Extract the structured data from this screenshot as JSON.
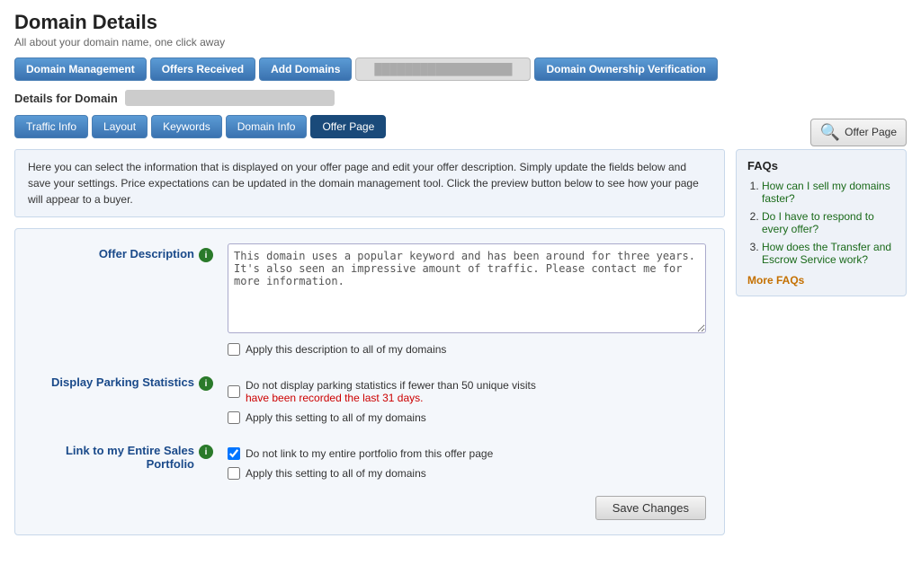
{
  "page": {
    "title": "Domain Details",
    "subtitle": "All about your domain name, one click away"
  },
  "top_nav": {
    "buttons": [
      {
        "id": "domain-management",
        "label": "Domain Management"
      },
      {
        "id": "offers-received",
        "label": "Offers Received"
      },
      {
        "id": "add-domains",
        "label": "Add Domains"
      }
    ],
    "domain_placeholder": "██████████████████",
    "right_button": {
      "id": "domain-ownership",
      "label": "Domain Ownership Verification"
    }
  },
  "details": {
    "label": "Details for Domain",
    "domain_name": "██████████████████"
  },
  "sub_tabs": [
    {
      "id": "traffic-info",
      "label": "Traffic Info",
      "active": false
    },
    {
      "id": "layout",
      "label": "Layout",
      "active": false
    },
    {
      "id": "keywords",
      "label": "Keywords",
      "active": false
    },
    {
      "id": "domain-info",
      "label": "Domain Info",
      "active": false
    },
    {
      "id": "offer-page",
      "label": "Offer Page",
      "active": true
    }
  ],
  "offer_page_btn": "Offer Page",
  "description_text": "Here you can select the information that is displayed on your offer page and edit your offer description. Simply update the fields below and save your settings. Price expectations can be updated in the domain management tool. Click the preview button below to see how your page will appear to a buyer.",
  "form": {
    "offer_description": {
      "label": "Offer Description",
      "value": "This domain uses a popular keyword and has been around for three years. It's also seen an impressive amount of traffic. Please contact me for more information.",
      "checkbox1": "Apply this description to all of my domains"
    },
    "display_parking": {
      "label": "Display Parking Statistics",
      "checkbox1_text1": "Do not display parking statistics if fewer than 50 unique visits",
      "checkbox1_text2": "have been recorded the last 31 days.",
      "checkbox2": "Apply this setting to all of my domains",
      "checked1": false,
      "checked2": false
    },
    "link_portfolio": {
      "label": "Link to my Entire Sales Portfolio",
      "checkbox1": "Do not link to my entire portfolio from this offer page",
      "checkbox2": "Apply this setting to all of my domains",
      "checked1": true,
      "checked2": false
    },
    "save_button": "Save Changes"
  },
  "faqs": {
    "title": "FAQs",
    "items": [
      {
        "text": "How can I sell my domains faster?"
      },
      {
        "text": "Do I have to respond to every offer?"
      },
      {
        "text": "How does the Transfer and Escrow Service work?"
      }
    ],
    "more_label": "More FAQs"
  }
}
